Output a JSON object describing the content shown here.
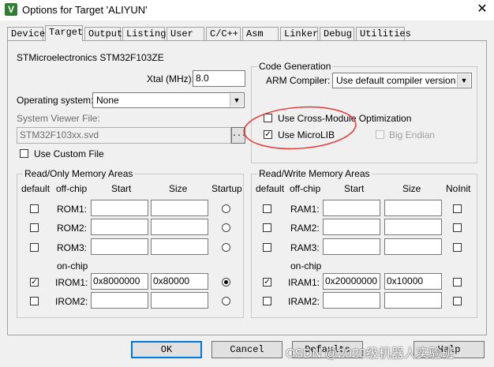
{
  "window": {
    "title": "Options for Target 'ALIYUN'",
    "app_icon": "V"
  },
  "tabs": [
    "Device",
    "Target",
    "Output",
    "Listing",
    "User",
    "C/C++",
    "Asm",
    "Linker",
    "Debug",
    "Utilities"
  ],
  "active_tab": "Target",
  "device": "STMicroelectronics STM32F103ZE",
  "xtal": {
    "label": "Xtal (MHz):",
    "value": "8.0"
  },
  "os": {
    "label": "Operating system:",
    "value": "None"
  },
  "svf": {
    "label": "System Viewer File:",
    "value": "STM32F103xx.svd",
    "browse": "..."
  },
  "custom_file": {
    "label": "Use Custom File",
    "checked": false
  },
  "code_gen": {
    "title": "Code Generation",
    "compiler_label": "ARM Compiler:",
    "compiler_value": "Use default compiler version",
    "cross_module": {
      "label": "Use Cross-Module Optimization",
      "checked": false
    },
    "microlib": {
      "label": "Use MicroLIB",
      "checked": true
    },
    "big_endian": {
      "label": "Big Endian",
      "checked": false
    }
  },
  "rom": {
    "title": "Read/Only Memory Areas",
    "headers": {
      "default": "default",
      "offchip": "off-chip",
      "start": "Start",
      "size": "Size",
      "last": "Startup"
    },
    "onchip_label": "on-chip",
    "rows": [
      {
        "name": "ROM1:",
        "start": "",
        "size": "",
        "checked": false,
        "selected": false
      },
      {
        "name": "ROM2:",
        "start": "",
        "size": "",
        "checked": false,
        "selected": false
      },
      {
        "name": "ROM3:",
        "start": "",
        "size": "",
        "checked": false,
        "selected": false
      },
      {
        "name": "IROM1:",
        "start": "0x8000000",
        "size": "0x80000",
        "checked": true,
        "selected": true
      },
      {
        "name": "IROM2:",
        "start": "",
        "size": "",
        "checked": false,
        "selected": false
      }
    ]
  },
  "ram": {
    "title": "Read/Write Memory Areas",
    "headers": {
      "default": "default",
      "offchip": "off-chip",
      "start": "Start",
      "size": "Size",
      "last": "NoInit"
    },
    "onchip_label": "on-chip",
    "rows": [
      {
        "name": "RAM1:",
        "start": "",
        "size": "",
        "checked": false,
        "noinit": false
      },
      {
        "name": "RAM2:",
        "start": "",
        "size": "",
        "checked": false,
        "noinit": false
      },
      {
        "name": "RAM3:",
        "start": "",
        "size": "",
        "checked": false,
        "noinit": false
      },
      {
        "name": "IRAM1:",
        "start": "0x20000000",
        "size": "0x10000",
        "checked": true,
        "noinit": false
      },
      {
        "name": "IRAM2:",
        "start": "",
        "size": "",
        "checked": false,
        "noinit": false
      }
    ]
  },
  "buttons": {
    "ok": "OK",
    "cancel": "Cancel",
    "defaults": "Defaults",
    "help": "Help"
  },
  "watermark": "CSDN @2020级机器人实验班",
  "colors": {
    "annotation_circle": "#e53935",
    "primary_button_border": "#0078d7"
  }
}
